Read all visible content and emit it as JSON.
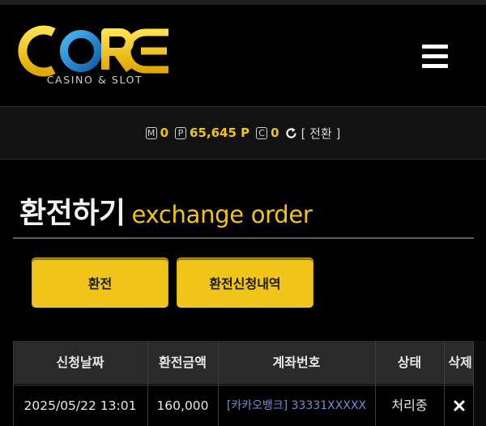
{
  "brand": {
    "logo_text": "CORE",
    "tagline": "CASINO & SLOT"
  },
  "points": {
    "m": {
      "badge": "M",
      "value": "0"
    },
    "p": {
      "badge": "P",
      "value": "65,645 P"
    },
    "c": {
      "badge": "C",
      "value": "0"
    },
    "switch_label": "[ 전환 ]"
  },
  "page": {
    "title_ko": "환전하기",
    "title_en": "exchange order"
  },
  "buttons": {
    "exchange": "환전",
    "history": "환전신청내역"
  },
  "table": {
    "headers": [
      "신청날짜",
      "환전금액",
      "계좌번호",
      "상태",
      "삭제"
    ],
    "rows": [
      {
        "date": "2025/05/22 13:01",
        "amount": "160,000",
        "account": "[카카오뱅크] 33331XXXXX",
        "status": "처리중"
      }
    ]
  },
  "colors": {
    "accent": "#f0c419",
    "logo_blue": "#1e8fd6",
    "link_blue": "#6f8fd6"
  }
}
